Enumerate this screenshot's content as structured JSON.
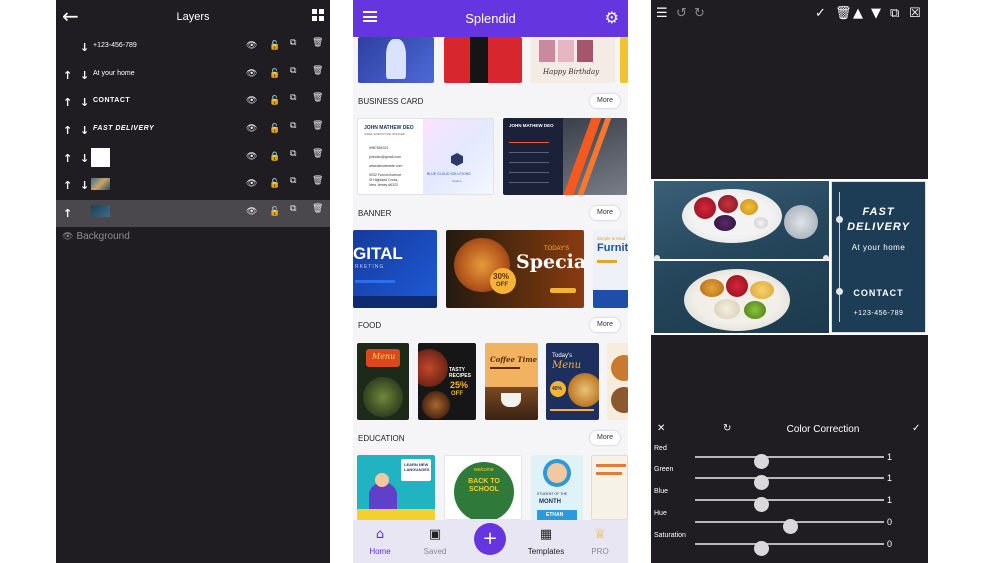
{
  "layers_screen": {
    "title": "Layers",
    "back_icon": "arrow-left-icon",
    "grid_icon": "grid-icon",
    "rows": [
      {
        "label": "+123-456-789",
        "thumb": "text",
        "up": false
      },
      {
        "label": "At your home",
        "thumb": "text",
        "up": true
      },
      {
        "label": "CONTACT",
        "thumb": "text-bold",
        "up": true
      },
      {
        "label": "FAST DELIVERY",
        "thumb": "text-bold",
        "up": true
      },
      {
        "label": "",
        "thumb": "white-box",
        "up": true,
        "locked": true
      },
      {
        "label": "",
        "thumb": "food-image",
        "up": true
      },
      {
        "label": "",
        "thumb": "panel-image",
        "up": true,
        "no_down": true,
        "selected": true
      }
    ],
    "background_label": "Background"
  },
  "templates_screen": {
    "app_title": "Splendid",
    "accent_color": "#6536e0",
    "sections": [
      {
        "title": "BUSINESS CARD",
        "more": "More"
      },
      {
        "title": "BANNER",
        "more": "More"
      },
      {
        "title": "FOOD",
        "more": "More"
      },
      {
        "title": "EDUCATION",
        "more": "More"
      }
    ],
    "cards": {
      "top_birthday": "Happy Birthday",
      "biz1_name": "JOHN MATHEW DEO",
      "biz1_role": "CHIEF EXECUTIVE OFFICER",
      "biz1_phone": "9987654321",
      "biz1_email": "johndeo@gmail.com",
      "biz1_web": "www.abcwebsite.com",
      "biz1_addr1": "9032 Foxrun Avenue",
      "biz1_addr2": "St Highland Cross,",
      "biz1_addr3": "New Jersey #6322",
      "biz1_company": "BLUE CLOUD SOLUTIONS",
      "biz1_tagline": "Tagline",
      "biz2_name": "JOHN MATHEW DEO",
      "banner1_big": "GITAL",
      "banner1_sub": "RKETING",
      "banner2_today": "TODAY'S",
      "banner2_special": "Special",
      "banner2_off_pct": "30%",
      "banner2_off": "OFF",
      "banner3_sub": "Simple & Mod",
      "banner3_big": "Furnit",
      "food1_title": "Menu",
      "food2_title": "TASTY RECIPES",
      "food2_pct": "25%",
      "food2_off": "OFF",
      "food3_title": "Coffee Time",
      "food4_today": "Today's",
      "food4_menu": "Menu",
      "food4_pct": "40%",
      "edu1_text": "LEARN NEW LANGUAGES",
      "edu2_welcome": "welcome",
      "edu2_text": "BACK TO SCHOOL",
      "edu3_label": "STUDENT OF THE",
      "edu3_month": "MONTH",
      "edu3_name": "ETHAN"
    },
    "nav": [
      {
        "label": "Home",
        "icon": "home-icon",
        "active": true
      },
      {
        "label": "Saved",
        "icon": "save-icon",
        "active": false
      },
      {
        "label": "Templates",
        "icon": "templates-icon",
        "active": false
      },
      {
        "label": "PRO",
        "icon": "crown-icon",
        "active": false
      }
    ],
    "fab_icon": "plus-icon"
  },
  "editor_screen": {
    "toolbar_icons": [
      "layers-icon",
      "undo-icon",
      "redo-icon",
      "check-icon",
      "trash-icon",
      "layer-up-icon",
      "layer-down-icon",
      "duplicate-icon",
      "close-box-icon"
    ],
    "design": {
      "headline1": "FAST",
      "headline2": "DELIVERY",
      "subline": "At your home",
      "contact": "CONTACT",
      "phone": "+123-456-789"
    },
    "color_correction": {
      "title": "Color Correction",
      "sliders": [
        {
          "label": "Red",
          "value": "1",
          "fraction": 0.35
        },
        {
          "label": "Green",
          "value": "1",
          "fraction": 0.35
        },
        {
          "label": "Blue",
          "value": "1",
          "fraction": 0.35
        },
        {
          "label": "Hue",
          "value": "0",
          "fraction": 0.5
        },
        {
          "label": "Saturation",
          "value": "0",
          "fraction": 0.35
        }
      ]
    }
  }
}
